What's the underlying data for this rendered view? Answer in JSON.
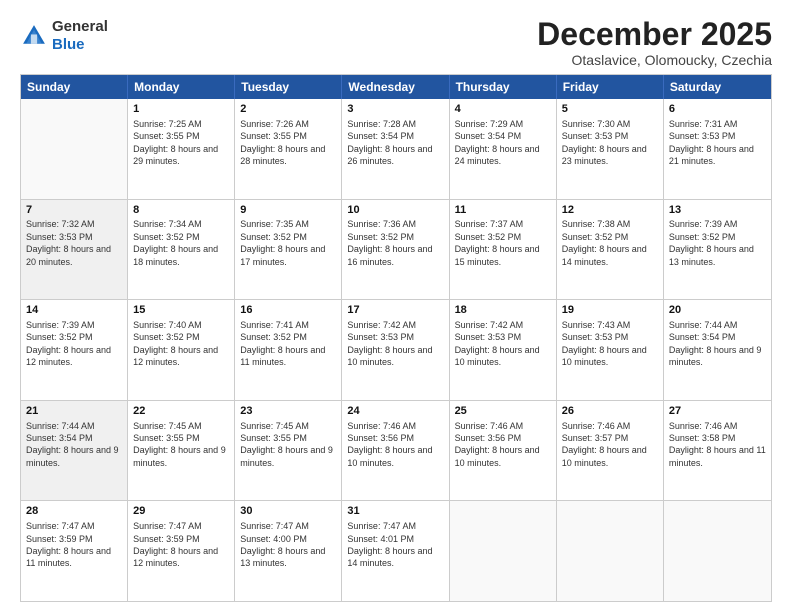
{
  "logo": {
    "general": "General",
    "blue": "Blue"
  },
  "header": {
    "month": "December 2025",
    "location": "Otaslavice, Olomoucky, Czechia"
  },
  "days": [
    "Sunday",
    "Monday",
    "Tuesday",
    "Wednesday",
    "Thursday",
    "Friday",
    "Saturday"
  ],
  "rows": [
    [
      {
        "day": "",
        "empty": true
      },
      {
        "day": "1",
        "sunrise": "Sunrise: 7:25 AM",
        "sunset": "Sunset: 3:55 PM",
        "daylight": "Daylight: 8 hours and 29 minutes."
      },
      {
        "day": "2",
        "sunrise": "Sunrise: 7:26 AM",
        "sunset": "Sunset: 3:55 PM",
        "daylight": "Daylight: 8 hours and 28 minutes."
      },
      {
        "day": "3",
        "sunrise": "Sunrise: 7:28 AM",
        "sunset": "Sunset: 3:54 PM",
        "daylight": "Daylight: 8 hours and 26 minutes."
      },
      {
        "day": "4",
        "sunrise": "Sunrise: 7:29 AM",
        "sunset": "Sunset: 3:54 PM",
        "daylight": "Daylight: 8 hours and 24 minutes."
      },
      {
        "day": "5",
        "sunrise": "Sunrise: 7:30 AM",
        "sunset": "Sunset: 3:53 PM",
        "daylight": "Daylight: 8 hours and 23 minutes."
      },
      {
        "day": "6",
        "sunrise": "Sunrise: 7:31 AM",
        "sunset": "Sunset: 3:53 PM",
        "daylight": "Daylight: 8 hours and 21 minutes."
      }
    ],
    [
      {
        "day": "7",
        "sunrise": "Sunrise: 7:32 AM",
        "sunset": "Sunset: 3:53 PM",
        "daylight": "Daylight: 8 hours and 20 minutes.",
        "shaded": true
      },
      {
        "day": "8",
        "sunrise": "Sunrise: 7:34 AM",
        "sunset": "Sunset: 3:52 PM",
        "daylight": "Daylight: 8 hours and 18 minutes."
      },
      {
        "day": "9",
        "sunrise": "Sunrise: 7:35 AM",
        "sunset": "Sunset: 3:52 PM",
        "daylight": "Daylight: 8 hours and 17 minutes."
      },
      {
        "day": "10",
        "sunrise": "Sunrise: 7:36 AM",
        "sunset": "Sunset: 3:52 PM",
        "daylight": "Daylight: 8 hours and 16 minutes."
      },
      {
        "day": "11",
        "sunrise": "Sunrise: 7:37 AM",
        "sunset": "Sunset: 3:52 PM",
        "daylight": "Daylight: 8 hours and 15 minutes."
      },
      {
        "day": "12",
        "sunrise": "Sunrise: 7:38 AM",
        "sunset": "Sunset: 3:52 PM",
        "daylight": "Daylight: 8 hours and 14 minutes."
      },
      {
        "day": "13",
        "sunrise": "Sunrise: 7:39 AM",
        "sunset": "Sunset: 3:52 PM",
        "daylight": "Daylight: 8 hours and 13 minutes."
      }
    ],
    [
      {
        "day": "14",
        "sunrise": "Sunrise: 7:39 AM",
        "sunset": "Sunset: 3:52 PM",
        "daylight": "Daylight: 8 hours and 12 minutes."
      },
      {
        "day": "15",
        "sunrise": "Sunrise: 7:40 AM",
        "sunset": "Sunset: 3:52 PM",
        "daylight": "Daylight: 8 hours and 12 minutes."
      },
      {
        "day": "16",
        "sunrise": "Sunrise: 7:41 AM",
        "sunset": "Sunset: 3:52 PM",
        "daylight": "Daylight: 8 hours and 11 minutes."
      },
      {
        "day": "17",
        "sunrise": "Sunrise: 7:42 AM",
        "sunset": "Sunset: 3:53 PM",
        "daylight": "Daylight: 8 hours and 10 minutes."
      },
      {
        "day": "18",
        "sunrise": "Sunrise: 7:42 AM",
        "sunset": "Sunset: 3:53 PM",
        "daylight": "Daylight: 8 hours and 10 minutes."
      },
      {
        "day": "19",
        "sunrise": "Sunrise: 7:43 AM",
        "sunset": "Sunset: 3:53 PM",
        "daylight": "Daylight: 8 hours and 10 minutes."
      },
      {
        "day": "20",
        "sunrise": "Sunrise: 7:44 AM",
        "sunset": "Sunset: 3:54 PM",
        "daylight": "Daylight: 8 hours and 9 minutes."
      }
    ],
    [
      {
        "day": "21",
        "sunrise": "Sunrise: 7:44 AM",
        "sunset": "Sunset: 3:54 PM",
        "daylight": "Daylight: 8 hours and 9 minutes.",
        "shaded": true
      },
      {
        "day": "22",
        "sunrise": "Sunrise: 7:45 AM",
        "sunset": "Sunset: 3:55 PM",
        "daylight": "Daylight: 8 hours and 9 minutes."
      },
      {
        "day": "23",
        "sunrise": "Sunrise: 7:45 AM",
        "sunset": "Sunset: 3:55 PM",
        "daylight": "Daylight: 8 hours and 9 minutes."
      },
      {
        "day": "24",
        "sunrise": "Sunrise: 7:46 AM",
        "sunset": "Sunset: 3:56 PM",
        "daylight": "Daylight: 8 hours and 10 minutes."
      },
      {
        "day": "25",
        "sunrise": "Sunrise: 7:46 AM",
        "sunset": "Sunset: 3:56 PM",
        "daylight": "Daylight: 8 hours and 10 minutes."
      },
      {
        "day": "26",
        "sunrise": "Sunrise: 7:46 AM",
        "sunset": "Sunset: 3:57 PM",
        "daylight": "Daylight: 8 hours and 10 minutes."
      },
      {
        "day": "27",
        "sunrise": "Sunrise: 7:46 AM",
        "sunset": "Sunset: 3:58 PM",
        "daylight": "Daylight: 8 hours and 11 minutes."
      }
    ],
    [
      {
        "day": "28",
        "sunrise": "Sunrise: 7:47 AM",
        "sunset": "Sunset: 3:59 PM",
        "daylight": "Daylight: 8 hours and 11 minutes."
      },
      {
        "day": "29",
        "sunrise": "Sunrise: 7:47 AM",
        "sunset": "Sunset: 3:59 PM",
        "daylight": "Daylight: 8 hours and 12 minutes."
      },
      {
        "day": "30",
        "sunrise": "Sunrise: 7:47 AM",
        "sunset": "Sunset: 4:00 PM",
        "daylight": "Daylight: 8 hours and 13 minutes."
      },
      {
        "day": "31",
        "sunrise": "Sunrise: 7:47 AM",
        "sunset": "Sunset: 4:01 PM",
        "daylight": "Daylight: 8 hours and 14 minutes."
      },
      {
        "day": "",
        "empty": true
      },
      {
        "day": "",
        "empty": true
      },
      {
        "day": "",
        "empty": true
      }
    ]
  ]
}
